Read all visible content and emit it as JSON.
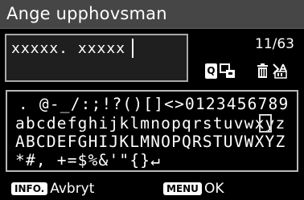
{
  "title": "Ange upphovsman",
  "input": {
    "value": "xxxxx. xxxxx"
  },
  "counter": "11/63",
  "icons": {
    "q": "Q",
    "swap": "text-mode-swap-icon",
    "trash": "trash-icon",
    "mode": "input-mode-icon"
  },
  "keyboard": {
    "rows": [
      ". @-_/:;!?()[]<>0123456789",
      "abcdefghijklmnopqrstuvwxyz",
      "ABCDEFGHIJKLMNOPQRSTUVWXYZ",
      "*#, +=$%&'\"{}↵"
    ],
    "selected": "x"
  },
  "footer": {
    "info_badge": "INFO.",
    "info_label": "Avbryt",
    "menu_badge": "MENU",
    "menu_label": "OK"
  },
  "colors": {
    "title_bar": "#464646",
    "background": "#000000",
    "input_bg": "#1f1f1f",
    "border": "#a9a9a9"
  }
}
